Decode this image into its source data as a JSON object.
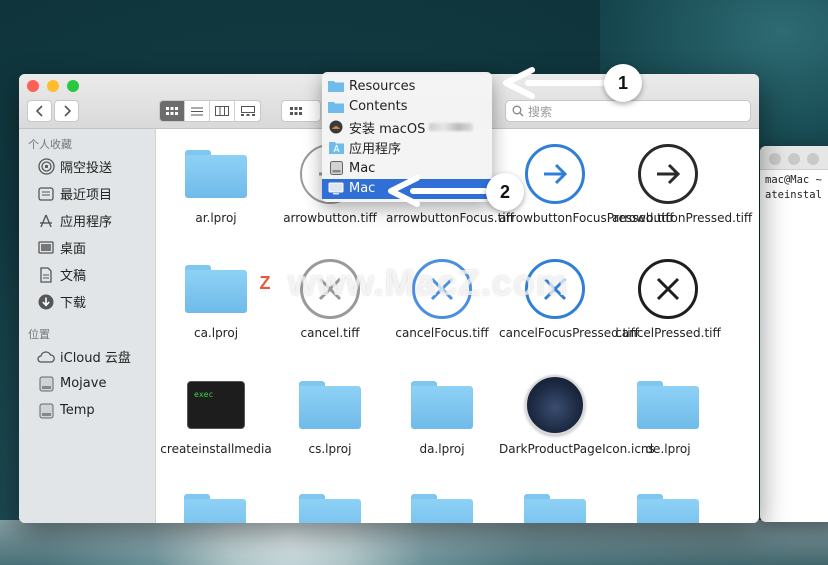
{
  "terminal": {
    "lines": [
      "mac@Mac ~",
      "ateinstal"
    ]
  },
  "search": {
    "placeholder": "搜索"
  },
  "sidebar": {
    "favorites_title": "个人收藏",
    "favorites": [
      {
        "label": "隔空投送",
        "icon": "airdrop-icon"
      },
      {
        "label": "最近项目",
        "icon": "recents-icon"
      },
      {
        "label": "应用程序",
        "icon": "applications-icon"
      },
      {
        "label": "桌面",
        "icon": "desktop-icon"
      },
      {
        "label": "文稿",
        "icon": "documents-icon"
      },
      {
        "label": "下载",
        "icon": "downloads-icon"
      }
    ],
    "locations_title": "位置",
    "locations": [
      {
        "label": "iCloud 云盘",
        "icon": "cloud-icon"
      },
      {
        "label": "Mojave",
        "icon": "disk-icon"
      },
      {
        "label": "Temp",
        "icon": "disk-icon"
      }
    ]
  },
  "path_menu": {
    "items": [
      {
        "label": "Resources",
        "icon": "folder-icon"
      },
      {
        "label": "Contents",
        "icon": "folder-icon"
      },
      {
        "label": "安装 macOS",
        "icon": "installer-icon"
      },
      {
        "label": "应用程序",
        "icon": "applications-icon"
      },
      {
        "label": "Mac",
        "icon": "disk-icon"
      },
      {
        "label": "Mac",
        "icon": "computer-icon",
        "selected": true
      }
    ]
  },
  "callouts": {
    "one": "1",
    "two": "2"
  },
  "files": {
    "row1": [
      {
        "name": "ar.lproj",
        "type": "folder"
      },
      {
        "name": "arrowbutton.tiff",
        "type": "arrow-gray"
      },
      {
        "name": "arrowbuttonFocus.tiff",
        "type": "arrow-blue-plain"
      },
      {
        "name": "arrowbuttonFocusPressed.tiff",
        "type": "arrow-blue"
      },
      {
        "name": "arrowbuttonPressed.tiff",
        "type": "arrow-black"
      }
    ],
    "row2": [
      {
        "name": "ca.lproj",
        "type": "folder"
      },
      {
        "name": "cancel.tiff",
        "type": "x-gray"
      },
      {
        "name": "cancelFocus.tiff",
        "type": "x-blue-plain"
      },
      {
        "name": "cancelFocusPressed.tiff",
        "type": "x-blue"
      },
      {
        "name": "cancelPressed.tiff",
        "type": "x-black"
      }
    ],
    "row3": [
      {
        "name": "createinstallmedia",
        "type": "exec",
        "thumb_text": "exec"
      },
      {
        "name": "cs.lproj",
        "type": "folder"
      },
      {
        "name": "da.lproj",
        "type": "folder"
      },
      {
        "name": "DarkProductPageIcon.icns",
        "type": "icns"
      },
      {
        "name": "de.lproj",
        "type": "folder"
      }
    ]
  },
  "watermark": {
    "text": "www.MacZ.com",
    "logo": "Z"
  },
  "colors": {
    "accent": "#2f6fd6",
    "folder": "#7fc6f0",
    "sidebar": "#e1e5e7"
  }
}
